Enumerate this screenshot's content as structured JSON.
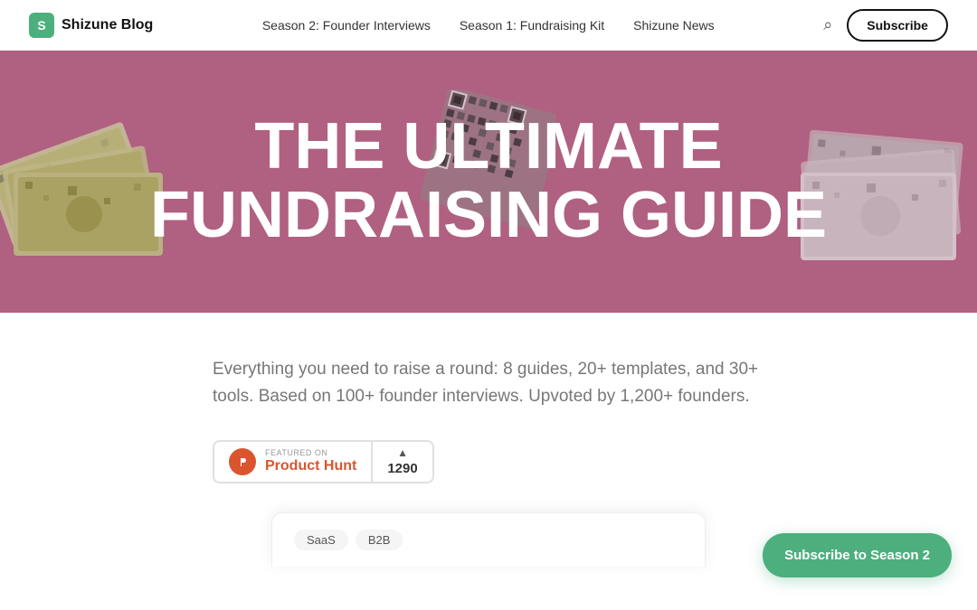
{
  "navbar": {
    "logo_letter": "S",
    "logo_name": "Shizune Blog",
    "nav_links": [
      {
        "label": "Season 2: Founder Interviews"
      },
      {
        "label": "Season 1: Fundraising Kit"
      },
      {
        "label": "Shizune News"
      }
    ],
    "subscribe_label": "Subscribe"
  },
  "hero": {
    "title_line1": "THE ULTIMATE",
    "title_line2": "FUNDRAISING GUIDE",
    "bg_color": "#b06080"
  },
  "content": {
    "description": "Everything you need to raise a round: 8 guides, 20+ templates, and 30+ tools. Based on 100+ founder interviews. Upvoted by 1,200+ founders.",
    "badge": {
      "featured_label": "FEATURED ON",
      "name": "Product Hunt",
      "count": "1290"
    }
  },
  "subscribe_floating": {
    "label": "Subscribe to Season 2"
  },
  "preview": {
    "tags": [
      "SaaS",
      "B2B"
    ]
  }
}
